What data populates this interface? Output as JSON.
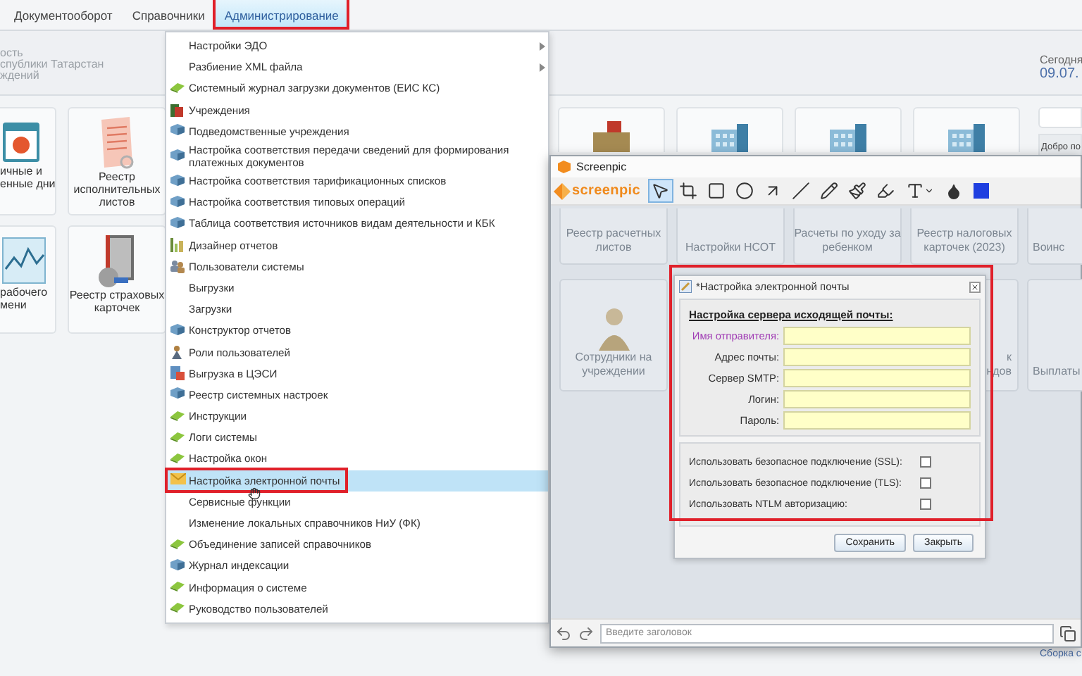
{
  "menu_bar": [
    {
      "label": "Документооборот",
      "selected": false,
      "marked": false
    },
    {
      "label": "Справочники",
      "selected": false,
      "marked": false
    },
    {
      "label": "Администрирование",
      "selected": true,
      "marked": true
    }
  ],
  "header": {
    "lines": [
      "ость",
      "спублики Татарстан",
      "ждений"
    ],
    "today_label": "Сегодня",
    "today_date": "09.07."
  },
  "tiles": [
    {
      "kind": "calendar",
      "lines": [
        "ичные и",
        "енные дни"
      ]
    },
    {
      "kind": "scroll",
      "lines": [
        "Реестр",
        "исполнительных",
        "листов"
      ]
    },
    {
      "kind": "graph",
      "lines": [
        "рабочего",
        "мени"
      ]
    },
    {
      "kind": "book",
      "lines": [
        "Реестр страховых",
        "карточек"
      ]
    }
  ],
  "back_tiles": [
    {
      "kind": "folder"
    },
    {
      "kind": "building"
    },
    {
      "kind": "building"
    },
    {
      "kind": "building"
    }
  ],
  "right_panel": {
    "greeting": "Добро по",
    "build": "Сборка с"
  },
  "admin_menu": [
    {
      "label": "Настройки ЭДО",
      "kind": "none",
      "has_submenu": true,
      "selected": false,
      "marked": false
    },
    {
      "label": "Разбиение XML файла",
      "kind": "none",
      "has_submenu": true,
      "selected": false,
      "marked": false
    },
    {
      "label": "Системный журнал загрузки документов (ЕИС КС)",
      "kind": "book",
      "has_submenu": false,
      "selected": false,
      "marked": false
    },
    {
      "label": "Учреждения",
      "kind": "building",
      "has_submenu": false,
      "selected": false,
      "marked": false
    },
    {
      "label": "Подведомственные учреждения",
      "kind": "cube",
      "has_submenu": false,
      "selected": false,
      "marked": false
    },
    {
      "label": "Настройка соответствия передачи сведений для формирования платежных документов",
      "kind": "cube",
      "has_submenu": false,
      "selected": false,
      "marked": false
    },
    {
      "label": "Настройка соответствия тарификационных списков",
      "kind": "cube",
      "has_submenu": false,
      "selected": false,
      "marked": false
    },
    {
      "label": "Настройка соответствия типовых операций",
      "kind": "cube",
      "has_submenu": false,
      "selected": false,
      "marked": false
    },
    {
      "label": "Таблица соответствия источников видам деятельности и КБК",
      "kind": "cube",
      "has_submenu": false,
      "selected": false,
      "marked": false
    },
    {
      "label": "Дизайнер отчетов",
      "kind": "chart",
      "has_submenu": false,
      "selected": false,
      "marked": false
    },
    {
      "label": "Пользователи системы",
      "kind": "users",
      "has_submenu": false,
      "selected": false,
      "marked": false
    },
    {
      "label": "Выгрузки",
      "kind": "none",
      "has_submenu": false,
      "selected": false,
      "marked": false
    },
    {
      "label": "Загрузки",
      "kind": "none",
      "has_submenu": false,
      "selected": false,
      "marked": false
    },
    {
      "label": "Конструктор отчетов",
      "kind": "cube",
      "has_submenu": false,
      "selected": false,
      "marked": false
    },
    {
      "label": "Роли пользователей",
      "kind": "person",
      "has_submenu": false,
      "selected": false,
      "marked": false
    },
    {
      "label": "Выгрузка в ЦЭСИ",
      "kind": "export",
      "has_submenu": false,
      "selected": false,
      "marked": false
    },
    {
      "label": "Реестр системных настроек",
      "kind": "cube",
      "has_submenu": false,
      "selected": false,
      "marked": false
    },
    {
      "label": "Инструкции",
      "kind": "book",
      "has_submenu": false,
      "selected": false,
      "marked": false
    },
    {
      "label": "Логи системы",
      "kind": "book",
      "has_submenu": false,
      "selected": false,
      "marked": false
    },
    {
      "label": "Настройка окон",
      "kind": "book",
      "has_submenu": false,
      "selected": false,
      "marked": false
    },
    {
      "label": "Настройка электронной почты",
      "kind": "mail",
      "has_submenu": false,
      "selected": true,
      "marked": true
    },
    {
      "label": "Сервисные функции",
      "kind": "none",
      "has_submenu": false,
      "selected": false,
      "marked": false
    },
    {
      "label": "Изменение локальных справочников НиУ (ФК)",
      "kind": "none",
      "has_submenu": false,
      "selected": false,
      "marked": false
    },
    {
      "label": "Объединение записей справочников",
      "kind": "book",
      "has_submenu": false,
      "selected": false,
      "marked": false
    },
    {
      "label": "Журнал индексации",
      "kind": "cube",
      "has_submenu": false,
      "selected": false,
      "marked": false
    },
    {
      "label": "Информация о системе",
      "kind": "book",
      "has_submenu": false,
      "selected": false,
      "marked": false
    },
    {
      "label": "Руководство пользователей",
      "kind": "book",
      "has_submenu": false,
      "selected": false,
      "marked": false
    }
  ],
  "screenpic": {
    "title": "Screenpic",
    "logo": "screenpic",
    "tools": [
      {
        "kind": "pointer",
        "selected": true
      },
      {
        "kind": "crop",
        "selected": false
      },
      {
        "kind": "rect",
        "selected": false
      },
      {
        "kind": "ellipse",
        "selected": false
      },
      {
        "kind": "arrow",
        "selected": false
      },
      {
        "kind": "line",
        "selected": false
      },
      {
        "kind": "pen",
        "selected": false
      },
      {
        "kind": "brush",
        "selected": false
      },
      {
        "kind": "marker",
        "selected": false
      },
      {
        "kind": "text",
        "selected": false
      },
      {
        "kind": "drop",
        "selected": false
      },
      {
        "kind": "swatch",
        "selected": false,
        "color": "#1f3fe0"
      }
    ],
    "tiles_row_1": [
      {
        "lines": [
          "Реестр расчетных",
          "листов"
        ]
      },
      {
        "lines": [
          "Настройки НСОТ"
        ]
      },
      {
        "lines": [
          "Расчеты по уходу за",
          "ребенком"
        ]
      },
      {
        "lines": [
          "Реестр налоговых",
          "карточек (2023)"
        ]
      },
      {
        "lines": [
          "Воинс"
        ]
      }
    ],
    "tiles_row_2": [
      {
        "kind": "person",
        "lines": [
          "Сотрудники на",
          "учреждении"
        ]
      },
      {
        "kind": "hidden",
        "lines": [
          "к",
          "ндов"
        ]
      },
      {
        "kind": "hidden",
        "lines": [
          "Выплаты"
        ]
      }
    ],
    "caption_placeholder": "Введите заголовок"
  },
  "dialog": {
    "title": "*Настройка электронной почты",
    "marked": true,
    "heading": "Настройка сервера исходящей почты:",
    "fields": [
      {
        "label": "Имя отправителя:",
        "active": true
      },
      {
        "label": "Адрес почты:",
        "active": false
      },
      {
        "label": "Сервер SMTP:",
        "active": false
      },
      {
        "label": "Логин:",
        "active": false
      },
      {
        "label": "Пароль:",
        "active": false
      }
    ],
    "options": [
      {
        "label": "Использовать безопасное подключение (SSL):",
        "checked": false
      },
      {
        "label": "Использовать безопасное подключение (TLS):",
        "checked": false
      },
      {
        "label": "Использовать NTLM авторизацию:",
        "checked": false
      }
    ],
    "buttons": [
      "Сохранить",
      "Закрыть"
    ]
  }
}
